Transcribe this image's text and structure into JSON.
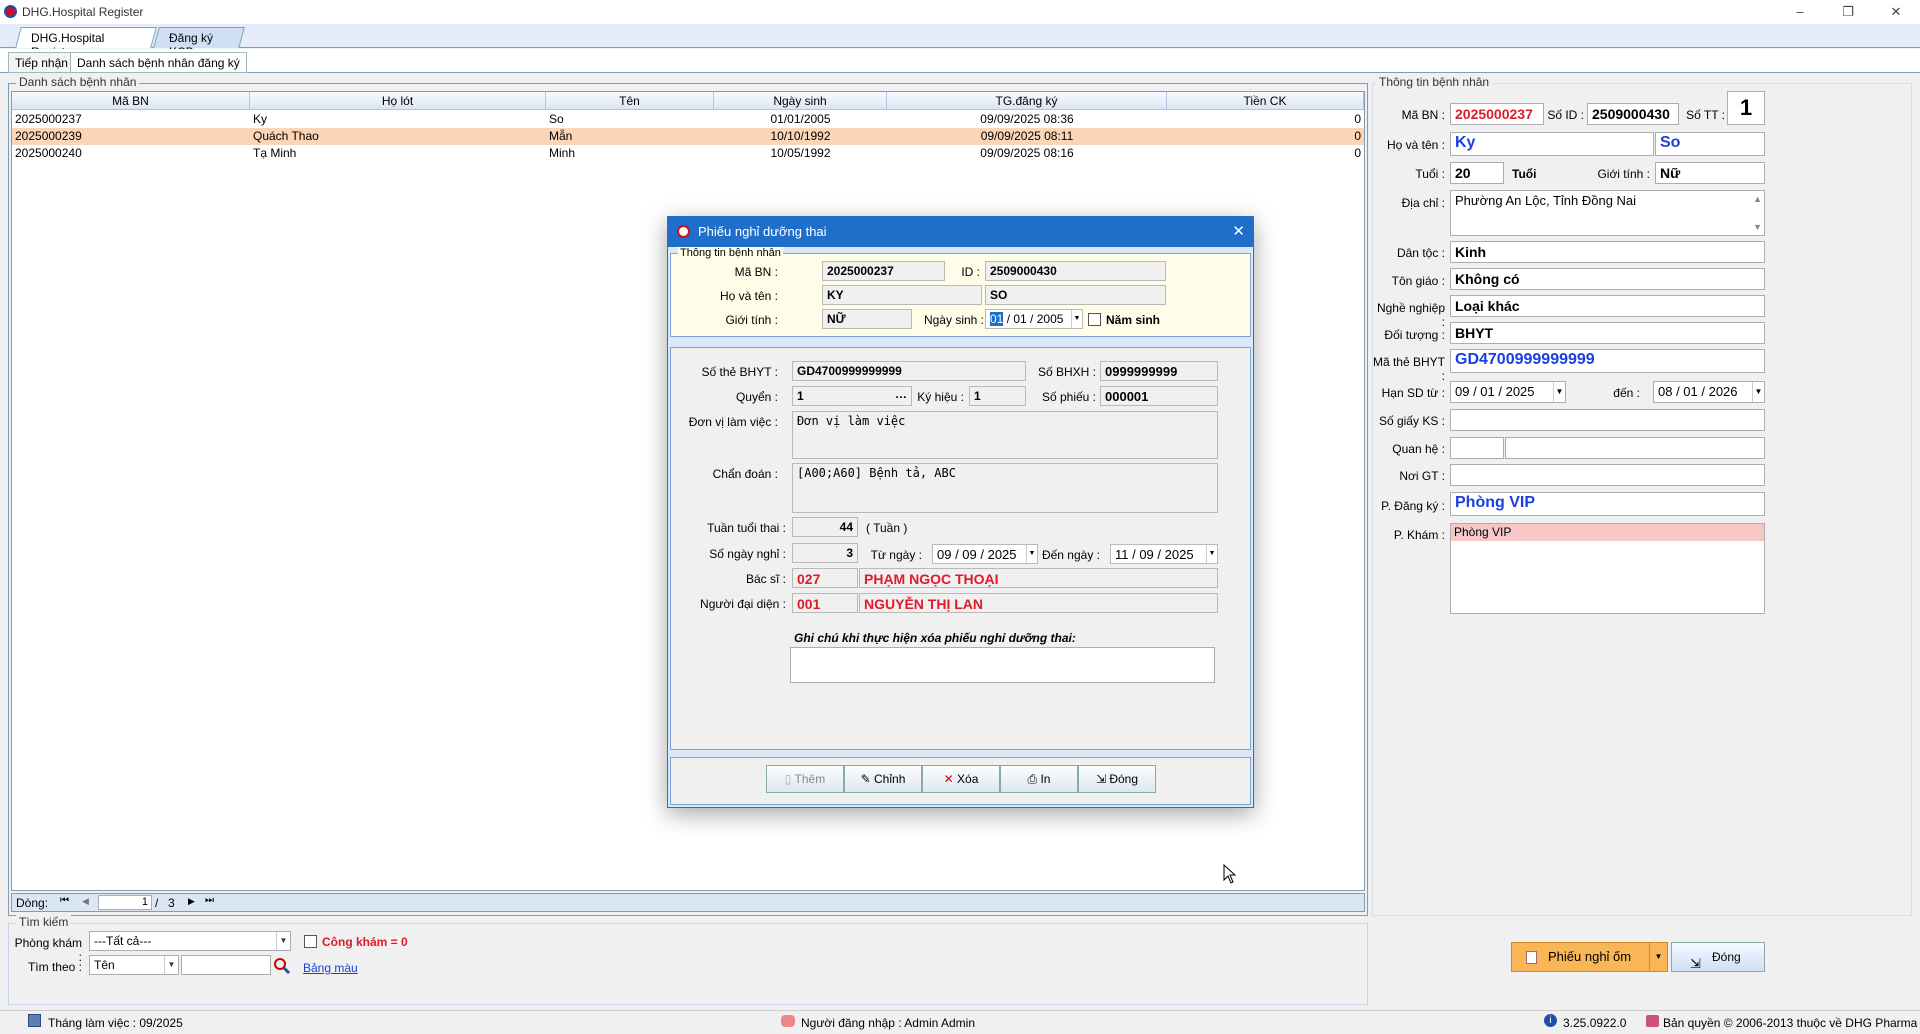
{
  "window": {
    "title": "DHG.Hospital Register",
    "minimize": "–",
    "restore": "❐",
    "close": "✕"
  },
  "top_tabs": [
    "DHG.Hospital Register",
    "Đăng ký KCB"
  ],
  "sub_tabs": [
    "Tiếp nhận",
    "Danh sách bệnh nhân đăng ký"
  ],
  "patient_list": {
    "group_label": "Danh sách bệnh nhân",
    "columns": [
      "Mã BN",
      "Họ lót",
      "Tên",
      "Ngày sinh",
      "TG.đăng ký",
      "Tiền CK"
    ],
    "rows": [
      {
        "ma_bn": "2025000237",
        "ho_lot": "Ky",
        "ten": "So",
        "ngay_sinh": "01/01/2005",
        "tg_dang_ky": "09/09/2025 08:36",
        "tien_ck": "0"
      },
      {
        "ma_bn": "2025000239",
        "ho_lot": "Quách Thao",
        "ten": "Mẫn",
        "ngay_sinh": "10/10/1992",
        "tg_dang_ky": "09/09/2025 08:11",
        "tien_ck": "0"
      },
      {
        "ma_bn": "2025000240",
        "ho_lot": "Tạ Minh",
        "ten": "Minh",
        "ngay_sinh": "10/05/1992",
        "tg_dang_ky": "09/09/2025 08:16",
        "tien_ck": "0"
      }
    ],
    "selected_row": 1
  },
  "pager": {
    "label": "Dòng:",
    "first": "⏮",
    "prev": "◀",
    "current": "1",
    "separator": "/",
    "total": "3",
    "next": "▶",
    "last": "⏭"
  },
  "search": {
    "group_label": "Tìm kiếm",
    "phong_kham_label": "Phòng khám :",
    "phong_kham_value": "---Tất cả---",
    "cong_kham": "Công khám = 0",
    "tim_theo_label": "Tìm theo :",
    "tim_theo_value": "Tên",
    "search_value": "",
    "bang_mau": "Bảng màu"
  },
  "patient_info": {
    "group_label": "Thông tin bệnh nhân",
    "ma_bn_label": "Mã BN :",
    "ma_bn": "2025000237",
    "so_id_label": "Số ID :",
    "so_id": "2509000430",
    "so_tt_label": "Số TT :",
    "so_tt": "1",
    "ho_ten_label": "Họ và tên :",
    "ho": "Ky",
    "ten": "So",
    "tuoi_label": "Tuổi :",
    "tuoi": "20",
    "tuoi_unit": "Tuổi",
    "gioi_tinh_label": "Giới tính :",
    "gioi_tinh": "Nữ",
    "dia_chi_label": "Địa chỉ :",
    "dia_chi": "Phường An Lộc, Tỉnh Đồng Nai",
    "dan_toc_label": "Dân tộc :",
    "dan_toc": "Kinh",
    "ton_giao_label": "Tôn giáo :",
    "ton_giao": "Không có",
    "nghe_nghiep_label": "Nghề nghiệp :",
    "nghe_nghiep": "Loại khác",
    "doi_tuong_label": "Đối tượng :",
    "doi_tuong": "BHYT",
    "ma_the_label": "Mã thẻ BHYT :",
    "ma_the": "GD4700999999999",
    "han_sd_label": "Hạn SD từ :",
    "han_sd_tu": "09 / 01 / 2025",
    "den_label": "đến :",
    "han_sd_den": "08 / 01 / 2026",
    "so_giay_ks_label": "Số giấy KS :",
    "so_giay_ks": "",
    "quan_he_label": "Quan hệ :",
    "quan_he_1": "",
    "quan_he_2": "",
    "noi_gt_label": "Nơi GT :",
    "noi_gt": "",
    "p_dang_ky_label": "P. Đăng ký :",
    "p_dang_ky": "Phòng VIP",
    "p_kham_label": "P. Khám :",
    "p_kham_items": [
      "Phòng VIP"
    ]
  },
  "bottom_buttons": {
    "phieu_nghi_om": "Phiếu nghỉ ốm",
    "dong": "Đóng"
  },
  "status_bar": {
    "thang": "Tháng làm việc : 09/2025",
    "user": "Người đăng nhập : Admin Admin",
    "version": "3.25.0922.0",
    "copyright": "Bản quyền © 2006-2013 thuộc về DHG Pharma"
  },
  "modal": {
    "title": "Phiếu nghỉ dưỡng thai",
    "patient_group_label": "Thông tin bệnh nhân",
    "ma_bn_label": "Mã BN :",
    "ma_bn": "2025000237",
    "id_label": "ID :",
    "id": "2509000430",
    "ho_ten_label": "Họ và tên :",
    "ho": "KY",
    "ten": "SO",
    "gioi_tinh_label": "Giới tính :",
    "gioi_tinh": "NỮ",
    "ngay_sinh_label": "Ngày sinh :",
    "ngay_sinh_day": "01",
    "ngay_sinh_rest": "/ 01 / 2005",
    "nam_sinh": "Năm sinh",
    "so_the_label": "Số thẻ BHYT :",
    "so_the": "GD4700999999999",
    "so_bhxh_label": "Số BHXH :",
    "so_bhxh": "0999999999",
    "quyen_label": "Quyển :",
    "quyen": "1",
    "ky_hieu_label": "Ký hiệu :",
    "ky_hieu": "1",
    "so_phieu_label": "Số phiếu :",
    "so_phieu": "000001",
    "don_vi_label": "Đơn vị làm việc :",
    "don_vi": "Đơn vị làm việc",
    "chan_doan_label": "Chẩn đoán :",
    "chan_doan": "[A00;A60] Bệnh tả, ABC",
    "tuan_tuoi_label": "Tuần tuổi thai :",
    "tuan_tuoi": "44",
    "tuan_unit": "( Tuần )",
    "so_ngay_label": "Số ngày nghỉ :",
    "so_ngay": "3",
    "tu_ngay_label": "Từ ngày :",
    "tu_ngay": "09 / 09 / 2025",
    "den_ngay_label": "Đến ngày :",
    "den_ngay": "11 / 09 / 2025",
    "bac_si_label": "Bác sĩ :",
    "bac_si_ma": "027",
    "bac_si_ten": "PHẠM NGỌC THOẠI",
    "nguoi_dai_dien_label": "Người đại diện :",
    "ndd_ma": "001",
    "ndd_ten": "NGUYỄN THỊ LAN",
    "ghi_chu_label": "Ghi chú khi thực hiện xóa phiếu nghỉ dưỡng thai:",
    "ghi_chu": "",
    "btn_them": "Thêm",
    "btn_chinh": "Chỉnh",
    "btn_xoa": "Xóa",
    "btn_in": "In",
    "btn_dong": "Đóng"
  },
  "colors": {
    "accent_blue": "#1f6ec9",
    "selected_row": "#fbd5b5",
    "red_text": "#e0192b",
    "blue_text": "#1a3fe0",
    "orange_button": "#f9b657"
  }
}
